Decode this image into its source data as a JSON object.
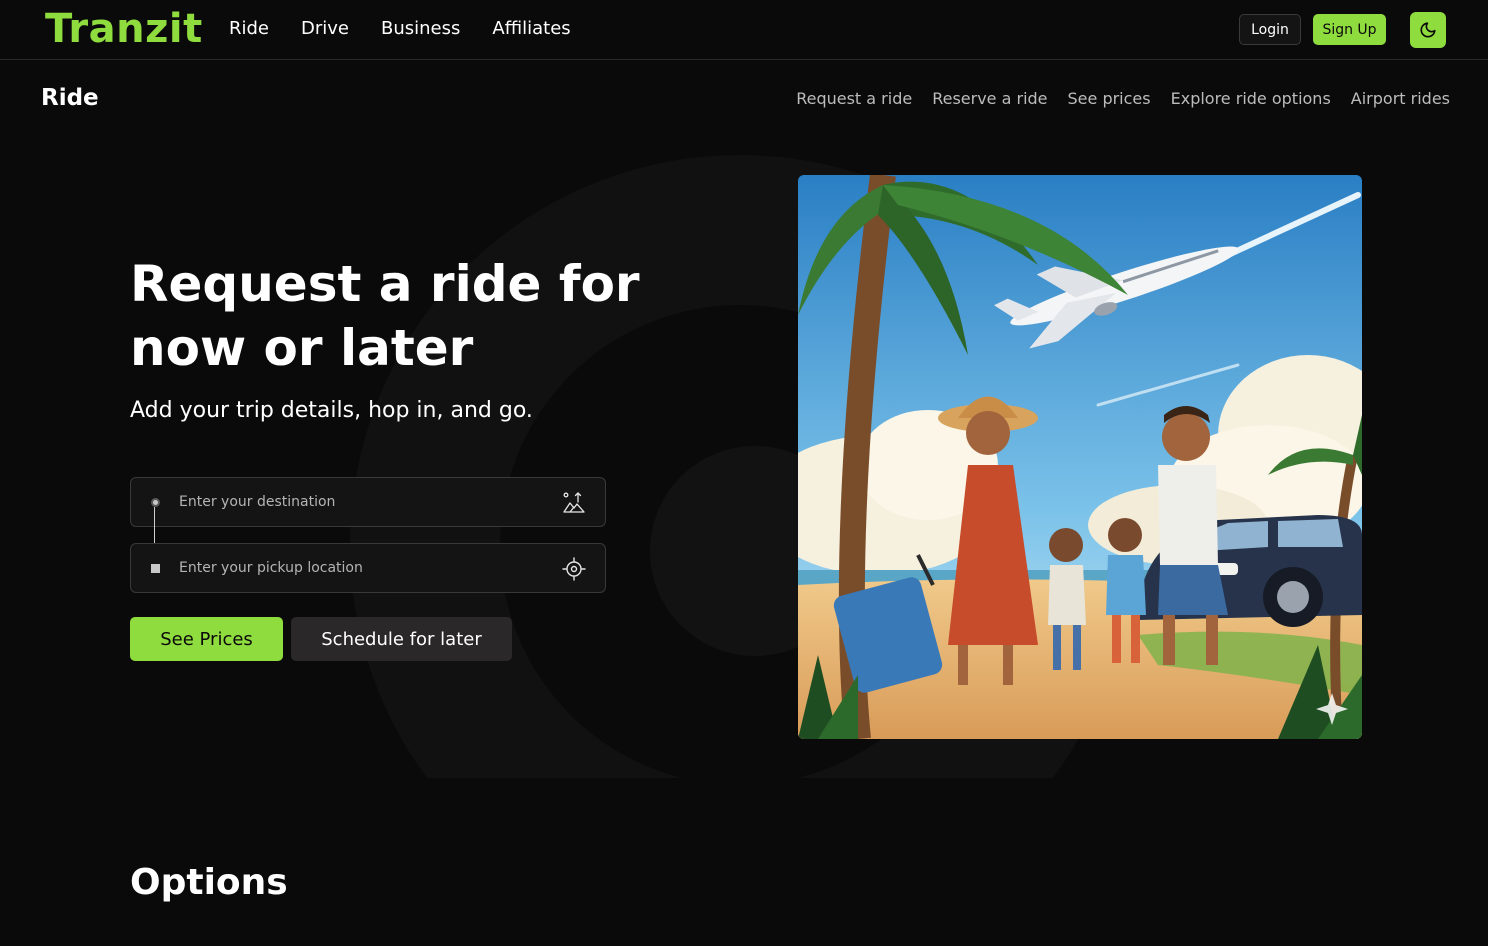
{
  "brand": {
    "name": "Tranzit",
    "accent": "#8fdc3e"
  },
  "top_nav": {
    "items": [
      {
        "label": "Ride"
      },
      {
        "label": "Drive"
      },
      {
        "label": "Business"
      },
      {
        "label": "Affiliates"
      }
    ],
    "login_label": "Login",
    "signup_label": "Sign Up",
    "theme_icon": "moon-icon"
  },
  "sub_nav": {
    "title": "Ride",
    "items": [
      {
        "label": "Request a ride"
      },
      {
        "label": "Reserve a ride"
      },
      {
        "label": "See prices"
      },
      {
        "label": "Explore ride options"
      },
      {
        "label": "Airport rides"
      }
    ]
  },
  "hero": {
    "title": "Request a ride for now or later",
    "subtitle": "Add your trip details, hop in, and go.",
    "destination_placeholder": "Enter your destination",
    "pickup_placeholder": "Enter your pickup location",
    "destination_icon": "map-pin-icon",
    "pickup_icon": "locate-crosshair-icon",
    "see_prices_label": "See Prices",
    "schedule_label": "Schedule for later",
    "image_icon": "family-airport-illustration"
  },
  "options": {
    "title": "Options"
  }
}
